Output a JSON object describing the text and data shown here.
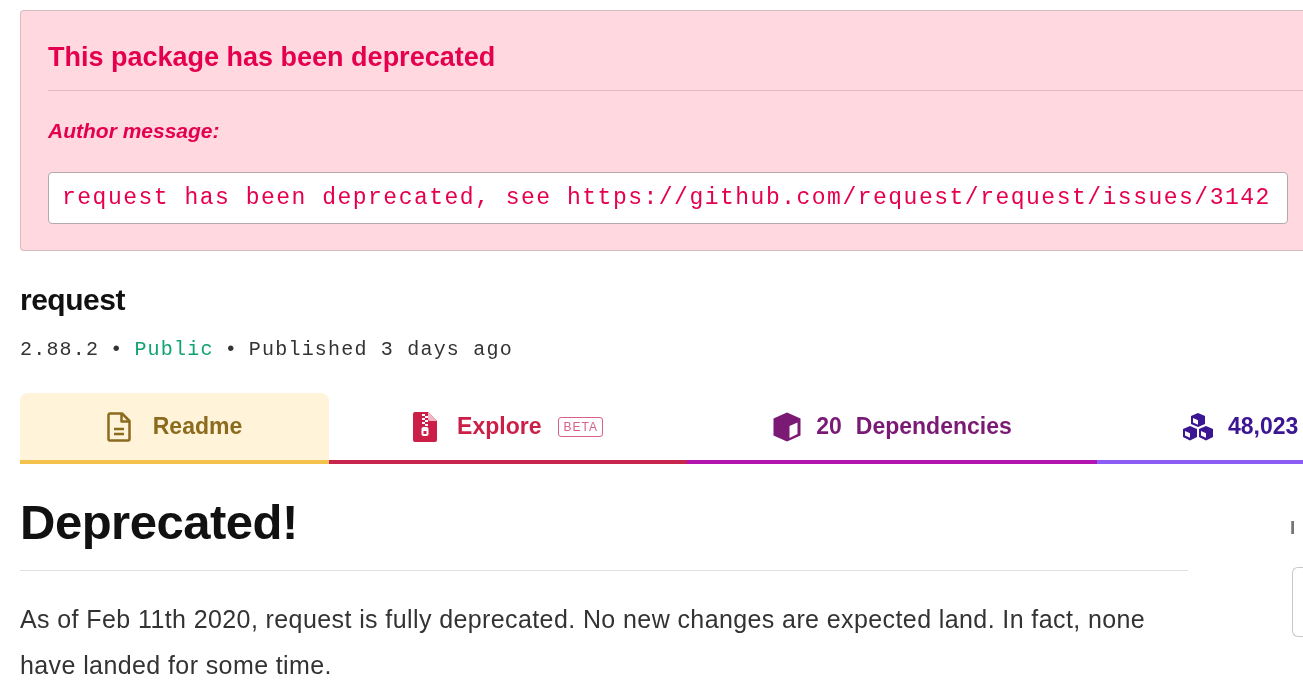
{
  "deprecation_notice": {
    "title": "This package has been deprecated",
    "label": "Author message:",
    "message": "request has been deprecated, see https://github.com/request/request/issues/3142"
  },
  "package": {
    "name": "request",
    "meta": [
      {
        "kind": "version",
        "text": "2.88.2"
      },
      {
        "kind": "separator",
        "text": "•"
      },
      {
        "kind": "visibility",
        "text": "Public"
      },
      {
        "kind": "separator",
        "text": "•"
      },
      {
        "kind": "published",
        "text": "Published 3 days ago"
      }
    ]
  },
  "tabs": [
    {
      "kind": "readme",
      "label": "Readme",
      "selected": true
    },
    {
      "kind": "explore",
      "label": "Explore",
      "badge": "BETA",
      "selected": false
    },
    {
      "kind": "dependencies",
      "count": "20",
      "label": "Dependencies",
      "selected": false
    },
    {
      "kind": "dependents",
      "count": "48,023",
      "selected": false
    }
  ],
  "readme": {
    "heading": "Deprecated!",
    "paragraph": "As of Feb 11th 2020, request is fully deprecated. No new changes are expected land. In fact, none have landed for some time."
  },
  "sidebar": {
    "label": "I"
  }
}
